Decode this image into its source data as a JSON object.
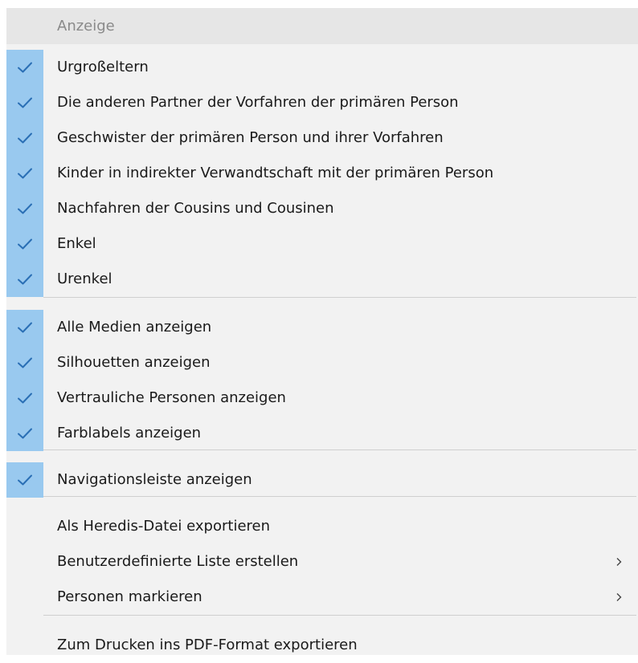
{
  "menu": {
    "header": "Anzeige",
    "groups": [
      {
        "items": [
          {
            "label": "Urgroßeltern",
            "checked": true
          },
          {
            "label": "Die anderen Partner der Vorfahren der primären Person",
            "checked": true
          },
          {
            "label": "Geschwister der primären Person und ihrer Vorfahren",
            "checked": true
          },
          {
            "label": "Kinder in indirekter Verwandtschaft mit der primären Person",
            "checked": true
          },
          {
            "label": "Nachfahren der Cousins und Cousinen",
            "checked": true
          },
          {
            "label": "Enkel",
            "checked": true
          },
          {
            "label": "Urenkel",
            "checked": true
          }
        ]
      },
      {
        "items": [
          {
            "label": "Alle Medien anzeigen",
            "checked": true
          },
          {
            "label": "Silhouetten anzeigen",
            "checked": true
          },
          {
            "label": "Vertrauliche Personen anzeigen",
            "checked": true
          },
          {
            "label": "Farblabels anzeigen",
            "checked": true
          }
        ]
      },
      {
        "items": [
          {
            "label": "Navigationsleiste anzeigen",
            "checked": true
          }
        ]
      },
      {
        "items": [
          {
            "label": "Als Heredis-Datei exportieren",
            "checked": false
          },
          {
            "label": "Benutzerdefinierte Liste erstellen",
            "checked": false,
            "submenu": true
          },
          {
            "label": "Personen markieren",
            "checked": false,
            "submenu": true
          }
        ]
      },
      {
        "items": [
          {
            "label": "Zum Drucken ins PDF-Format exportieren",
            "checked": false
          }
        ]
      }
    ],
    "icons": {
      "check": "checkmark-icon",
      "submenu": "chevron-right-icon"
    },
    "colors": {
      "check_strip": "#99c9ef",
      "check_mark": "#2a6fb5",
      "background": "#f2f2f2",
      "header_bg": "#e6e6e6",
      "separator": "#cfcfcf"
    }
  }
}
